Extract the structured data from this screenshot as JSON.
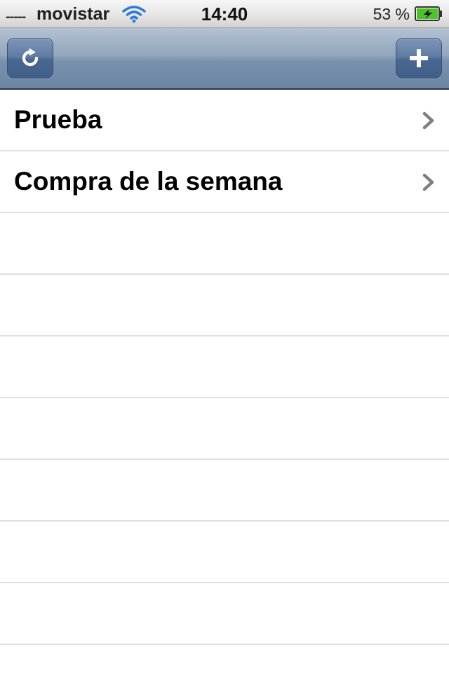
{
  "status_bar": {
    "signal": "-----",
    "carrier": "movistar",
    "time": "14:40",
    "battery_percent": "53 %",
    "icons": [
      "signal-dots-icon",
      "wifi-icon",
      "battery-charging-icon"
    ]
  },
  "navbar": {
    "left_button_icon": "refresh-icon",
    "right_button_icon": "add-icon",
    "tint_color": "#6a84a3"
  },
  "lists": [
    {
      "label": "Prueba",
      "icon": "chevron-right-icon"
    },
    {
      "label": "Compra de la semana",
      "icon": "chevron-right-icon"
    }
  ],
  "colors": {
    "battery_fill": "#4cc22a",
    "separator": "#e0e0e0",
    "chevron": "#7f7f7f"
  }
}
